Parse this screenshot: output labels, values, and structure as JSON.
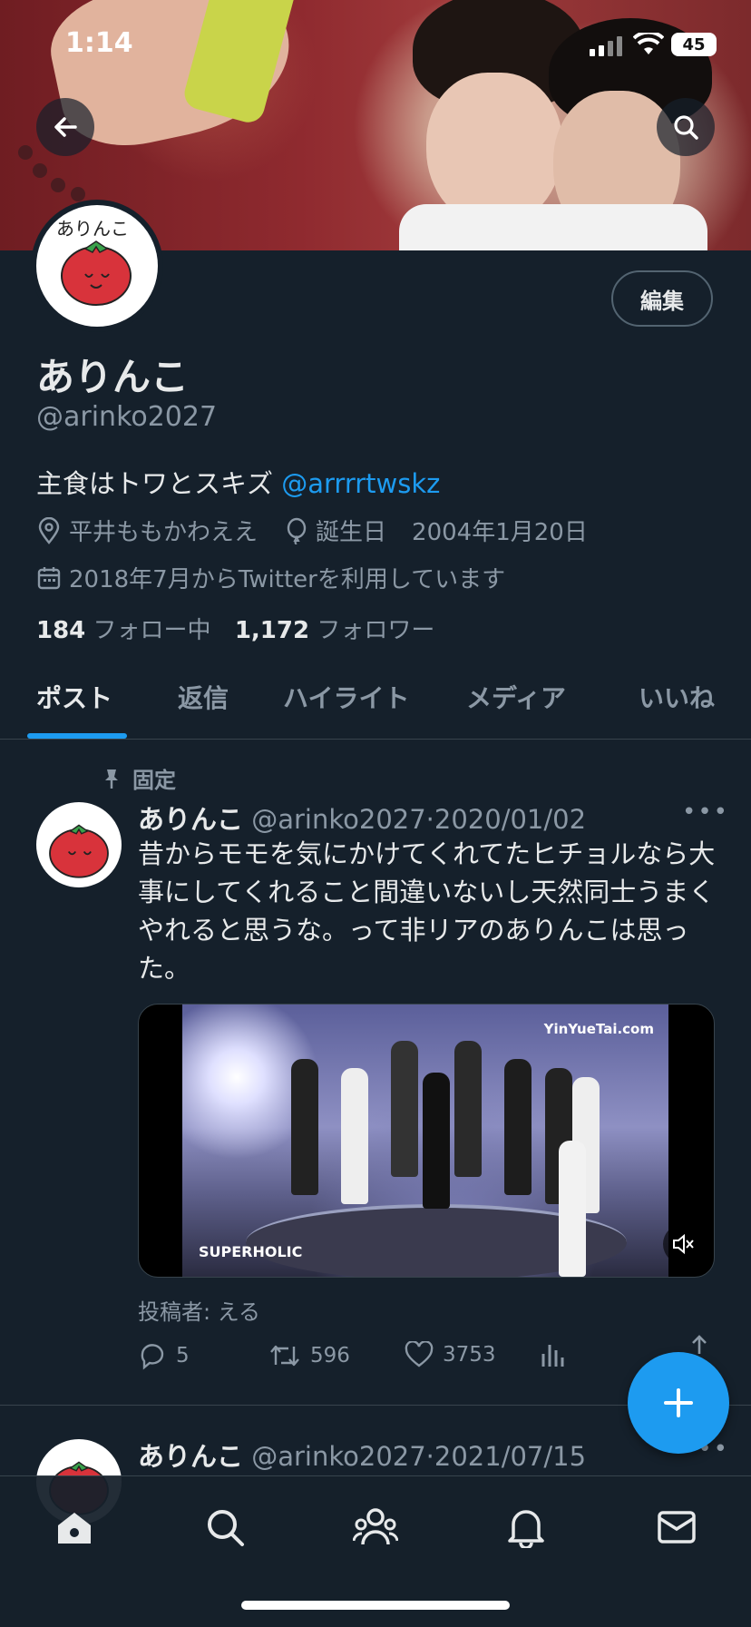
{
  "status_bar": {
    "time": "1:14",
    "battery": "45"
  },
  "profile": {
    "edit_label": "編集",
    "name": "ありんこ",
    "handle": "@arinko2027",
    "bio_text": "主食はトワとスキズ ",
    "bio_link": "@arrrrtwskz",
    "location": "平井ももかわええ",
    "birthday_label": "誕生日",
    "birthday": "2004年1月20日",
    "joined": "2018年7月からTwitterを利用しています",
    "following_count": "184",
    "following_label": "フォロー中",
    "followers_count": "1,172",
    "followers_label": "フォロワー",
    "avatar_text": "ありんこ"
  },
  "tabs": [
    "ポスト",
    "返信",
    "ハイライト",
    "メディア",
    "いいね"
  ],
  "tweets": [
    {
      "pinned_label": "固定",
      "name": "ありんこ",
      "handle": "@arinko2027",
      "date": "2020/01/02",
      "text": "昔からモモを気にかけてくれてたヒチョルなら大事にしてくれること間違いないし天然同士うまくやれると思うな。って非リアのありんこは思った。",
      "media": {
        "watermark": "YinYueTai.com",
        "caption": "SUPERHOLIC"
      },
      "poster": "投稿者: える",
      "replies": "5",
      "retweets": "596",
      "likes": "3753"
    },
    {
      "name": "ありんこ",
      "handle": "@arinko2027",
      "date": "2021/07/15"
    }
  ],
  "colors": {
    "background": "#15202b",
    "accent": "#1d9bf0",
    "muted": "#8b98a5"
  },
  "icons": [
    "back-arrow-icon",
    "search-icon",
    "location-icon",
    "balloon-icon",
    "calendar-icon",
    "pin-icon",
    "reply-icon",
    "retweet-icon",
    "like-icon",
    "views-icon",
    "share-icon",
    "mute-icon",
    "plus-icon",
    "home-icon",
    "people-icon",
    "bell-icon",
    "mail-icon"
  ]
}
